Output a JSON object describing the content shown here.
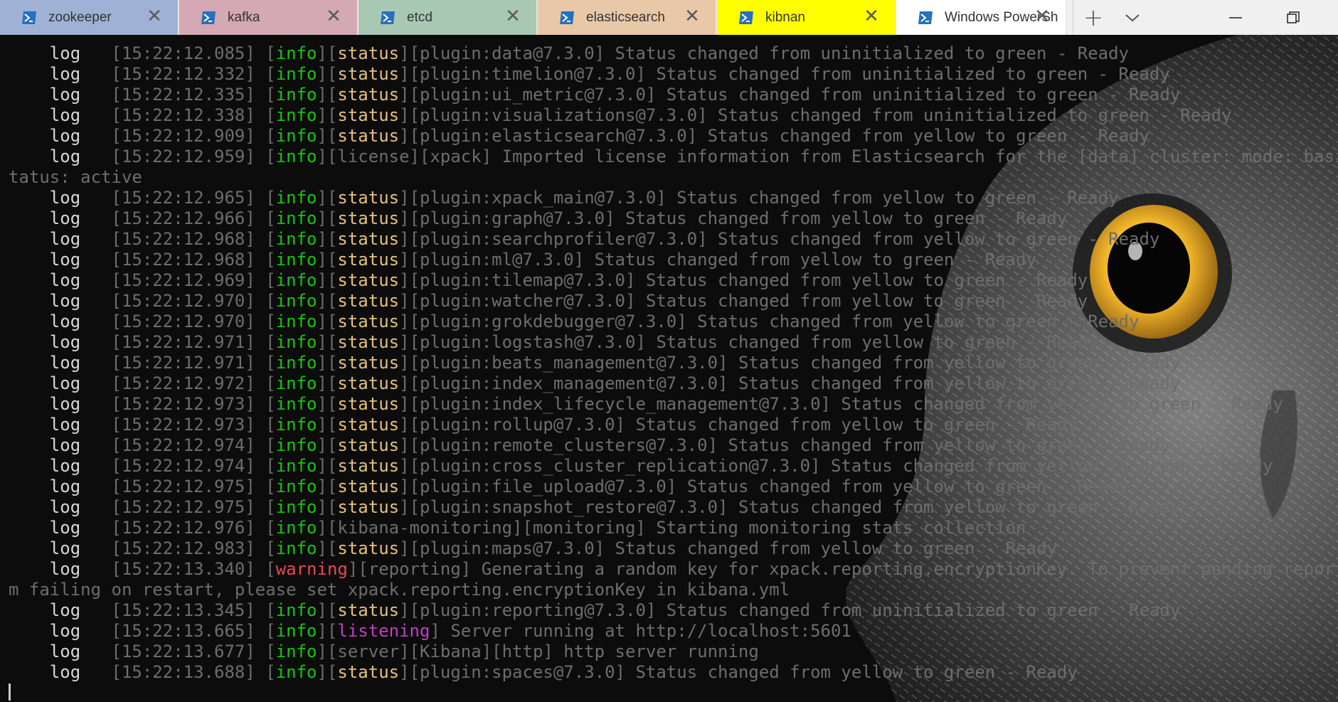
{
  "tabs": [
    {
      "title": "zookeeper",
      "color": "#9fb1d4"
    },
    {
      "title": "kafka",
      "color": "#d4a8b4"
    },
    {
      "title": "etcd",
      "color": "#a8c8b4"
    },
    {
      "title": "elasticsearch",
      "color": "#e8c8a8"
    },
    {
      "title": "kibnan",
      "color": "#ffff00"
    },
    {
      "title": "Windows PowerSh",
      "color": "#ffffff"
    }
  ],
  "tab_close_glyph": "✕",
  "new_tab_glyph": "+",
  "icons": {
    "tab_icon": "powershell-icon",
    "dropdown": "chevron-down-icon",
    "minimize": "minimize-icon",
    "restore": "restore-icon",
    "background": "owl-background-image"
  },
  "log_lines": [
    {
      "lv": "    log   ",
      "ts": "[15:22:12.085] ",
      "lvl": "info",
      "l2": "status",
      "rest": "[plugin:data@7.3.0] Status changed from uninitialized to green - Ready"
    },
    {
      "lv": "    log   ",
      "ts": "[15:22:12.332] ",
      "lvl": "info",
      "l2": "status",
      "rest": "[plugin:timelion@7.3.0] Status changed from uninitialized to green - Ready"
    },
    {
      "lv": "    log   ",
      "ts": "[15:22:12.335] ",
      "lvl": "info",
      "l2": "status",
      "rest": "[plugin:ui_metric@7.3.0] Status changed from uninitialized to green - Ready"
    },
    {
      "lv": "    log   ",
      "ts": "[15:22:12.338] ",
      "lvl": "info",
      "l2": "status",
      "rest": "[plugin:visualizations@7.3.0] Status changed from uninitialized to green - Ready"
    },
    {
      "lv": "    log   ",
      "ts": "[15:22:12.909] ",
      "lvl": "info",
      "l2": "status",
      "rest": "[plugin:elasticsearch@7.3.0] Status changed from yellow to green - Ready"
    },
    {
      "lv": "    log   ",
      "ts": "[15:22:12.959] ",
      "lvl": "info",
      "l2": "",
      "rest": "[license][xpack] Imported license information from Elasticsearch for the [data] cluster: mode: basic | s"
    },
    {
      "lv": "",
      "ts": "",
      "lvl": "",
      "l2": "",
      "rest": "tatus: active"
    },
    {
      "lv": "    log   ",
      "ts": "[15:22:12.965] ",
      "lvl": "info",
      "l2": "status",
      "rest": "[plugin:xpack_main@7.3.0] Status changed from yellow to green - Ready"
    },
    {
      "lv": "    log   ",
      "ts": "[15:22:12.966] ",
      "lvl": "info",
      "l2": "status",
      "rest": "[plugin:graph@7.3.0] Status changed from yellow to green - Ready"
    },
    {
      "lv": "    log   ",
      "ts": "[15:22:12.968] ",
      "lvl": "info",
      "l2": "status",
      "rest": "[plugin:searchprofiler@7.3.0] Status changed from yellow to green - Ready"
    },
    {
      "lv": "    log   ",
      "ts": "[15:22:12.968] ",
      "lvl": "info",
      "l2": "status",
      "rest": "[plugin:ml@7.3.0] Status changed from yellow to green - Ready"
    },
    {
      "lv": "    log   ",
      "ts": "[15:22:12.969] ",
      "lvl": "info",
      "l2": "status",
      "rest": "[plugin:tilemap@7.3.0] Status changed from yellow to green - Ready"
    },
    {
      "lv": "    log   ",
      "ts": "[15:22:12.970] ",
      "lvl": "info",
      "l2": "status",
      "rest": "[plugin:watcher@7.3.0] Status changed from yellow to green - Ready"
    },
    {
      "lv": "    log   ",
      "ts": "[15:22:12.970] ",
      "lvl": "info",
      "l2": "status",
      "rest": "[plugin:grokdebugger@7.3.0] Status changed from yellow to green - Ready"
    },
    {
      "lv": "    log   ",
      "ts": "[15:22:12.971] ",
      "lvl": "info",
      "l2": "status",
      "rest": "[plugin:logstash@7.3.0] Status changed from yellow to green - Ready"
    },
    {
      "lv": "    log   ",
      "ts": "[15:22:12.971] ",
      "lvl": "info",
      "l2": "status",
      "rest": "[plugin:beats_management@7.3.0] Status changed from yellow to green - Ready"
    },
    {
      "lv": "    log   ",
      "ts": "[15:22:12.972] ",
      "lvl": "info",
      "l2": "status",
      "rest": "[plugin:index_management@7.3.0] Status changed from yellow to green - Ready"
    },
    {
      "lv": "    log   ",
      "ts": "[15:22:12.973] ",
      "lvl": "info",
      "l2": "status",
      "rest": "[plugin:index_lifecycle_management@7.3.0] Status changed from yellow to green - Ready"
    },
    {
      "lv": "    log   ",
      "ts": "[15:22:12.973] ",
      "lvl": "info",
      "l2": "status",
      "rest": "[plugin:rollup@7.3.0] Status changed from yellow to green - Ready"
    },
    {
      "lv": "    log   ",
      "ts": "[15:22:12.974] ",
      "lvl": "info",
      "l2": "status",
      "rest": "[plugin:remote_clusters@7.3.0] Status changed from yellow to green - Ready"
    },
    {
      "lv": "    log   ",
      "ts": "[15:22:12.974] ",
      "lvl": "info",
      "l2": "status",
      "rest": "[plugin:cross_cluster_replication@7.3.0] Status changed from yellow to green - Ready"
    },
    {
      "lv": "    log   ",
      "ts": "[15:22:12.975] ",
      "lvl": "info",
      "l2": "status",
      "rest": "[plugin:file_upload@7.3.0] Status changed from yellow to green - Ready"
    },
    {
      "lv": "    log   ",
      "ts": "[15:22:12.975] ",
      "lvl": "info",
      "l2": "status",
      "rest": "[plugin:snapshot_restore@7.3.0] Status changed from yellow to green - Ready"
    },
    {
      "lv": "    log   ",
      "ts": "[15:22:12.976] ",
      "lvl": "info",
      "l2": "",
      "rest": "[kibana-monitoring][monitoring] Starting monitoring stats collection"
    },
    {
      "lv": "    log   ",
      "ts": "[15:22:12.983] ",
      "lvl": "info",
      "l2": "status",
      "rest": "[plugin:maps@7.3.0] Status changed from yellow to green - Ready"
    },
    {
      "lv": "    log   ",
      "ts": "[15:22:13.340] ",
      "lvl": "warning",
      "l2": "",
      "rest": "[reporting] Generating a random key for xpack.reporting.encryptionKey. To prevent pending reports fro"
    },
    {
      "lv": "",
      "ts": "",
      "lvl": "",
      "l2": "",
      "rest": "m failing on restart, please set xpack.reporting.encryptionKey in kibana.yml"
    },
    {
      "lv": "    log   ",
      "ts": "[15:22:13.345] ",
      "lvl": "info",
      "l2": "status",
      "rest": "[plugin:reporting@7.3.0] Status changed from uninitialized to green - Ready"
    },
    {
      "lv": "    log   ",
      "ts": "[15:22:13.665] ",
      "lvl": "info",
      "l2": "listening",
      "rest": " Server running at http://localhost:5601"
    },
    {
      "lv": "    log   ",
      "ts": "[15:22:13.677] ",
      "lvl": "info",
      "l2": "",
      "rest": "[server][Kibana][http] http server running"
    },
    {
      "lv": "    log   ",
      "ts": "[15:22:13.688] ",
      "lvl": "info",
      "l2": "status",
      "rest": "[plugin:spaces@7.3.0] Status changed from yellow to green - Ready"
    }
  ]
}
